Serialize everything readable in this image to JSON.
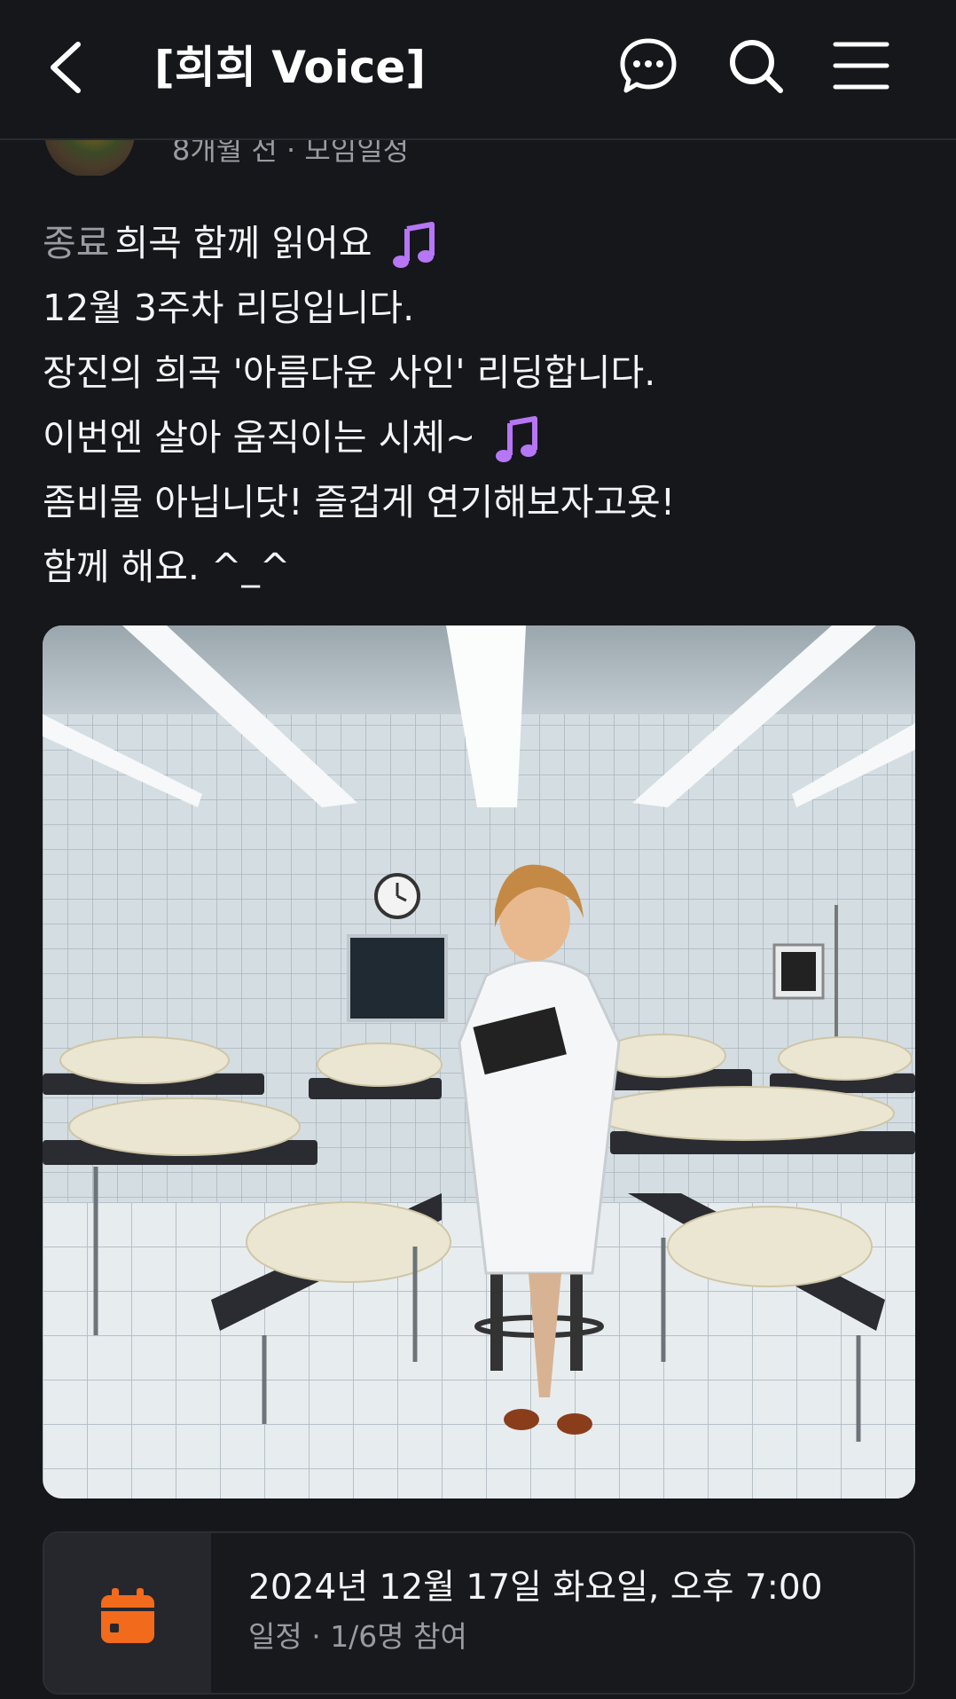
{
  "header": {
    "title": "[희희 Voice]",
    "icons": [
      "back-chevron-icon",
      "chat-bubble-icon",
      "search-icon",
      "hamburger-menu-icon"
    ]
  },
  "post": {
    "meta": "8개월 전 · 모임일정",
    "status_label": "종료",
    "title": "희곡 함께 읽어요",
    "lines": [
      "12월 3주차 리딩입니다.",
      "장진의 희곡 '아름다운 사인' 리딩합니다.",
      "이번엔 살아 움직이는 시체~",
      "좀비물 아닙니닷! 즐겁게 연기해보자고욧!",
      "함께 해요. ^_^"
    ],
    "emoji_icon": "music-note-icon"
  },
  "schedule": {
    "date": "2024년 12월 17일 화요일, 오후 7:00",
    "sub": "일정 · 1/6명 참여",
    "icon": "calendar-icon"
  },
  "colors": {
    "background": "#16171b",
    "text": "#f4f4f6",
    "muted": "#9a9ba2",
    "note_purple": "#b676f5",
    "calendar_orange": "#f26a1b"
  }
}
